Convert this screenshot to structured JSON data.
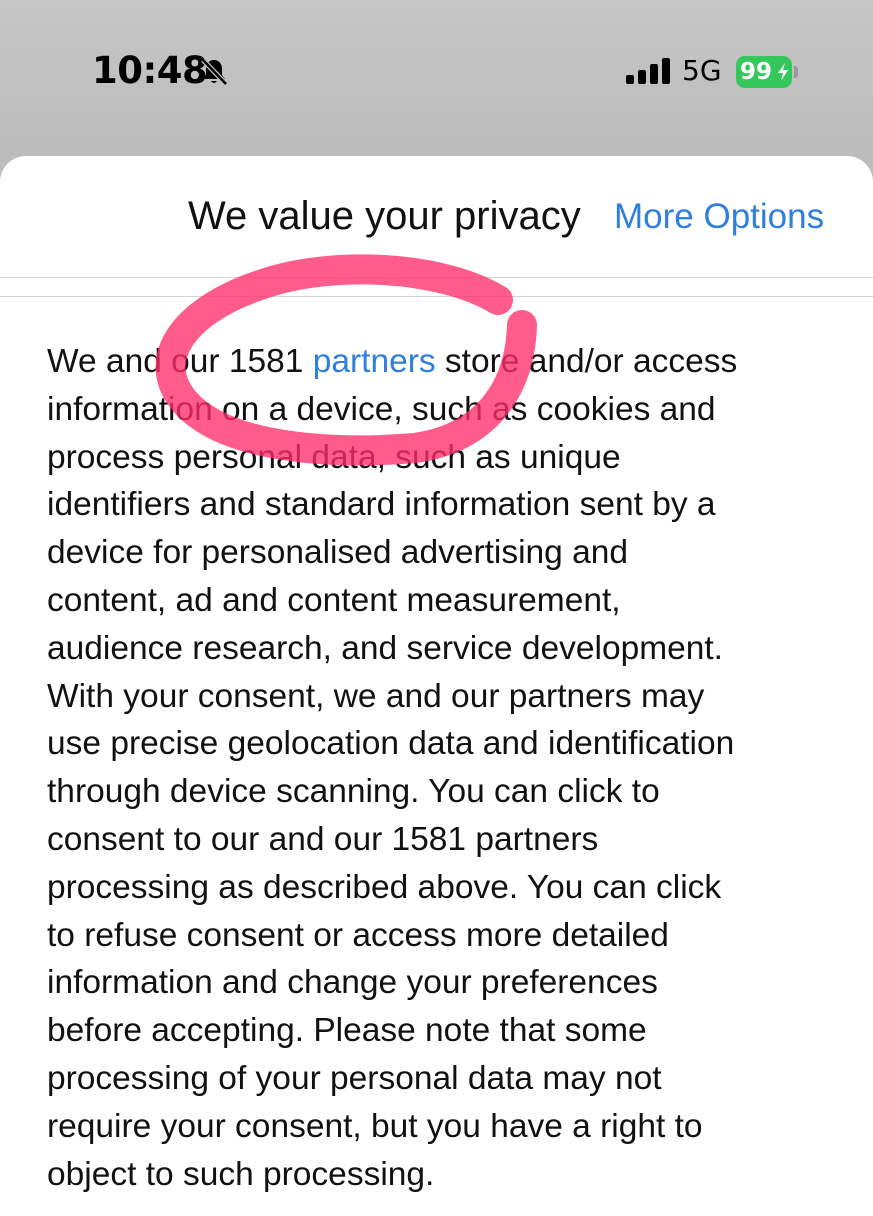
{
  "status_bar": {
    "time": "10:48",
    "network": "5G",
    "battery": "99",
    "icons": [
      "bell-slash-icon",
      "cellular-signal-icon",
      "battery-charging-icon"
    ],
    "battery_color": "#34c759"
  },
  "dialog": {
    "title": "We value your privacy",
    "more_options": "More Options",
    "link_color": "#2f7fe0",
    "body": {
      "line1_before": "We and our 1581 ",
      "line1_link": "partners",
      "line1_after": " store and/or access",
      "lines": [
        "information on a device, such as cookies and",
        "process personal data, such as unique",
        "identifiers and standard information sent by a",
        "device for personalised advertising and",
        "content, ad and content measurement,",
        "audience research, and service development.",
        "With your consent, we and our partners may",
        "use precise geolocation data and identification",
        "through device scanning. You can click to",
        "consent to our and our 1581 partners",
        "processing as described above. You can click",
        "to refuse consent or access more detailed",
        "information and change your preferences",
        "before accepting. Please note that some",
        "processing of your personal data may not",
        "require your consent, but you have a right to",
        "object to such processing."
      ]
    }
  },
  "annotation": {
    "type": "hand-drawn-circle",
    "color": "#ff2d6a"
  }
}
